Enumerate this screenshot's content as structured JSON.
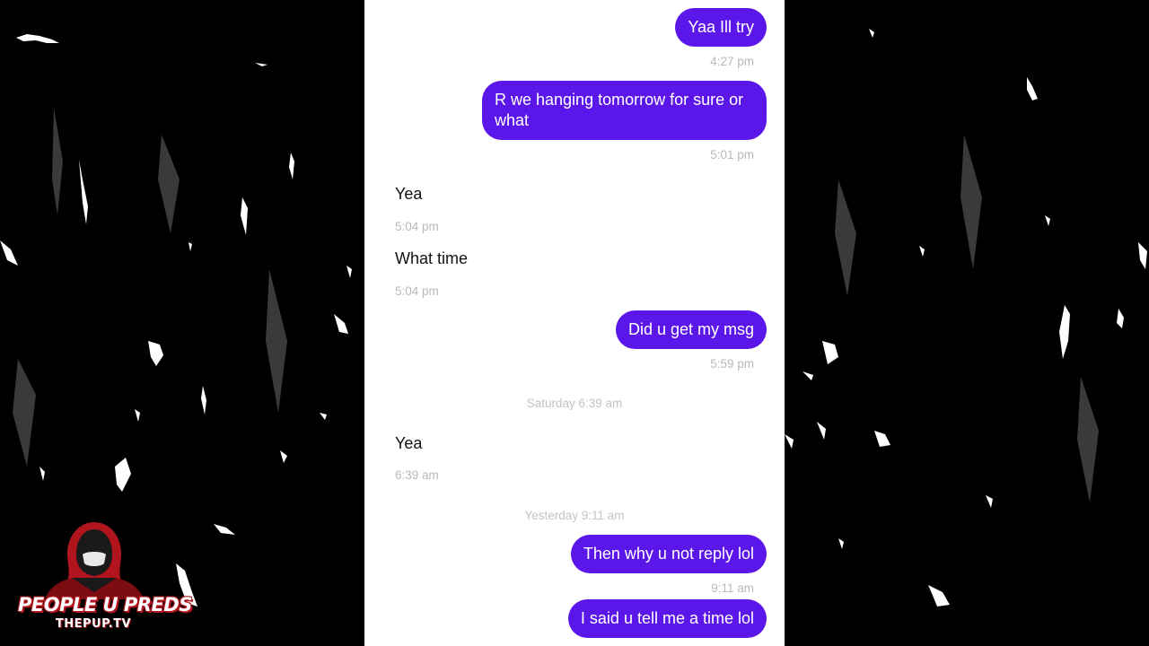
{
  "messages": [
    {
      "dir": "out",
      "text": "Yaa Ill try",
      "time": "4:27 pm"
    },
    {
      "dir": "out",
      "text": "R we hanging tomorrow for sure or what",
      "time": "5:01 pm"
    },
    {
      "dir": "in",
      "text": "Yea",
      "time": "5:04 pm"
    },
    {
      "dir": "in",
      "text": "What time",
      "time": "5:04 pm"
    },
    {
      "dir": "out",
      "text": "Did u get my msg",
      "time": "5:59 pm"
    },
    {
      "divider": "Saturday 6:39 am"
    },
    {
      "dir": "in",
      "text": "Yea",
      "time": "6:39 am"
    },
    {
      "divider": "Yesterday 9:11 am"
    },
    {
      "dir": "out",
      "text": "Then why u not reply lol",
      "time": "9:11 am"
    },
    {
      "dir": "out",
      "text": "I said u tell me a time lol"
    }
  ],
  "logo": {
    "title": "PEOPLE U PREDS",
    "subtitle": "THEPUP.TV"
  },
  "colors": {
    "outgoing_bubble": "#5b17ea",
    "background": "#000000",
    "chat_background": "#ffffff",
    "timestamp": "#b9b9b9",
    "logo_accent": "#b0141c"
  }
}
